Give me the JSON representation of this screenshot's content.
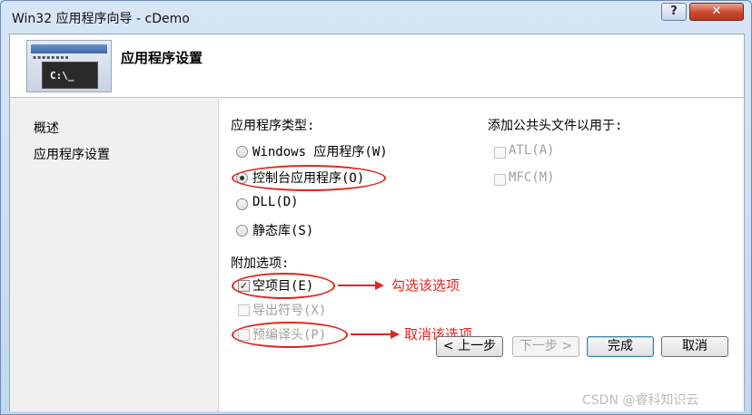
{
  "window": {
    "title": "Win32 应用程序向导 - cDemo",
    "help_label": "?",
    "close_label": "✕"
  },
  "header": {
    "icon": "console-app-icon",
    "console_text": "C:\\_",
    "title": "应用程序设置"
  },
  "sidebar": {
    "items": [
      {
        "label": "概述"
      },
      {
        "label": "应用程序设置"
      }
    ]
  },
  "app_type": {
    "heading": "应用程序类型:",
    "options": [
      {
        "label": "Windows 应用程序(W)",
        "selected": false
      },
      {
        "label": "控制台应用程序(O)",
        "selected": true
      },
      {
        "label": "DLL(D)",
        "selected": false
      },
      {
        "label": "静态库(S)",
        "selected": false
      }
    ]
  },
  "common_headers": {
    "heading": "添加公共头文件以用于:",
    "options": [
      {
        "label": "ATL(A)",
        "checked": false
      },
      {
        "label": "MFC(M)",
        "checked": false
      }
    ]
  },
  "additional": {
    "heading": "附加选项:",
    "options": [
      {
        "label": "空项目(E)",
        "checked": true,
        "enabled": true
      },
      {
        "label": "导出符号(X)",
        "checked": false,
        "enabled": false
      },
      {
        "label": "预编译头(P)",
        "checked": false,
        "enabled": false
      }
    ]
  },
  "annotations": {
    "check_this": "勾选该选项",
    "uncheck_this": "取消该选项"
  },
  "buttons": {
    "prev": "< 上一步",
    "next": "下一步 >",
    "finish": "完成",
    "cancel": "取消"
  },
  "watermark": "CSDN @睿科知识云",
  "colors": {
    "annotation_red": "#e0261d"
  }
}
